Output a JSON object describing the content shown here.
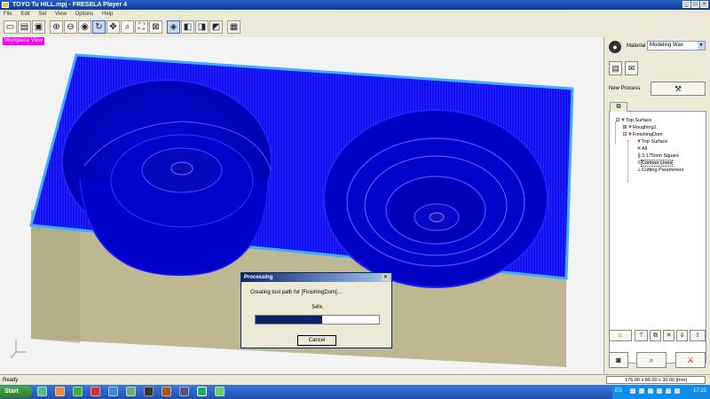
{
  "window": {
    "title": "TOYO Tu HILL.mpj - FRESELA Player 4"
  },
  "menu": [
    "File",
    "Edit",
    "Set",
    "View",
    "Options",
    "Help"
  ],
  "toolbar": {
    "buttons": [
      "new-file",
      "open-folder",
      "save",
      "zoom-in",
      "zoom-out",
      "pan",
      "rotate",
      "fit",
      "select",
      "zoom-window",
      "fit-all",
      "iso-view",
      "front-view",
      "top-view",
      "side-view",
      "shaded-view",
      "wire-view"
    ],
    "active": [
      "rotate",
      "shaded-view"
    ]
  },
  "viewport": {
    "label": "Workpiece View"
  },
  "dialog": {
    "title": "Processing",
    "message": "Creating tool path for [FinishingDom]...",
    "percent_text": "54%",
    "progress": 0.54,
    "cancel_label": "Cancel",
    "close_glyph": "✕"
  },
  "panel": {
    "material_label": "Material",
    "material_value": "Modeling Wax",
    "new_process_label": "New Process",
    "tree": [
      {
        "label": "Top Surface",
        "level": 1,
        "icon": "surface-icon"
      },
      {
        "label": "Roughing1",
        "level": 1,
        "icon": "tool-icon"
      },
      {
        "label": "FinishingDom",
        "level": 1,
        "icon": "tool-icon"
      },
      {
        "label": "Top Surface",
        "level": 2,
        "icon": "surface-icon"
      },
      {
        "label": "All",
        "level": 2,
        "icon": "cross-icon"
      },
      {
        "label": "3.175mm Square",
        "level": 2,
        "icon": "bit-icon"
      },
      {
        "label": "Contour Lines",
        "level": 2,
        "icon": "lines-icon",
        "selected": true
      },
      {
        "label": "Cutting Parameters",
        "level": 2,
        "icon": "params-icon"
      }
    ]
  },
  "status": {
    "ready": "Ready",
    "dimensions": "176.00 x 86.00 x 30.00 [mm]"
  },
  "taskbar": {
    "start_label": "Start",
    "lang": "ES",
    "time": "17:22"
  },
  "colors": {
    "toolpath": "#0000ee",
    "stock_side": "#bdb891",
    "stock_edge": "#44aaff",
    "progress_fill": "#0a246a"
  }
}
